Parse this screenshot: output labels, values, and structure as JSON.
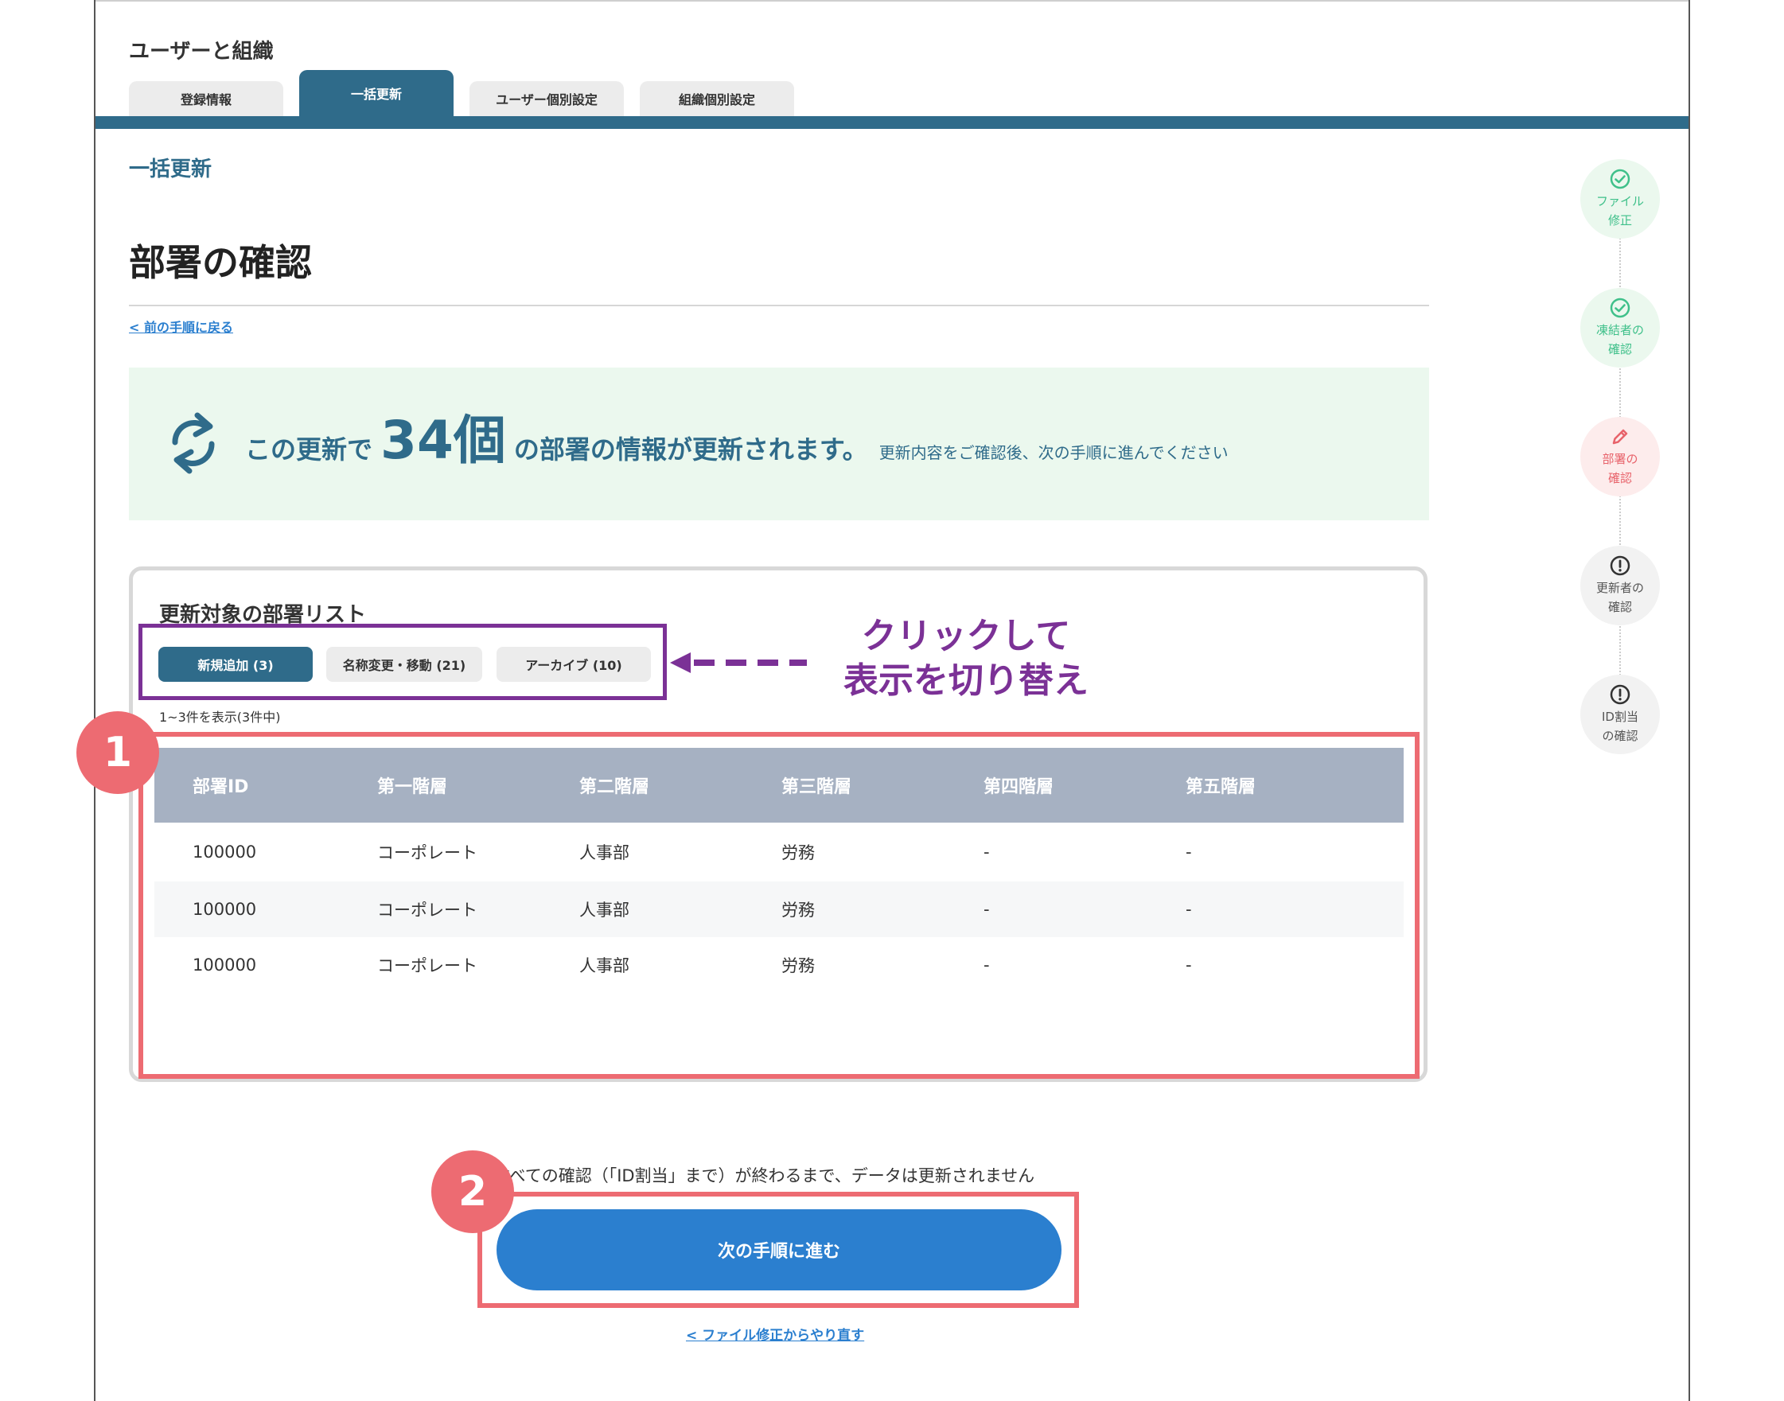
{
  "app": {
    "title": "ユーザーと組織"
  },
  "tabs": [
    {
      "label": "登録情報"
    },
    {
      "label": "一括更新"
    },
    {
      "label": "ユーザー個別設定"
    },
    {
      "label": "組織個別設定"
    }
  ],
  "section_label": "一括更新",
  "page_title": "部署の確認",
  "back_link": "< 前の手順に戻る",
  "banner": {
    "prefix": "この更新で",
    "count": "34個",
    "suffix": "の部署の情報が更新されます。",
    "sub": "更新内容をご確認後、次の手順に進んでください",
    "icon": "sync-icon"
  },
  "list": {
    "title": "更新対象の部署リスト",
    "filters": [
      {
        "label": "新規追加 (3)"
      },
      {
        "label": "名称変更・移動 (21)"
      },
      {
        "label": "アーカイブ (10)"
      }
    ],
    "count_text": "1~3件を表示(3件中)",
    "columns": [
      "部署ID",
      "第一階層",
      "第二階層",
      "第三階層",
      "第四階層",
      "第五階層"
    ],
    "rows": [
      [
        "100000",
        "コーポレート",
        "人事部",
        "労務",
        "-",
        "-"
      ],
      [
        "100000",
        "コーポレート",
        "人事部",
        "労務",
        "-",
        "-"
      ],
      [
        "100000",
        "コーポレート",
        "人事部",
        "労務",
        "-",
        "-"
      ]
    ]
  },
  "annotation": {
    "line1": "クリックして",
    "line2": "表示を切り替え",
    "color": "#7b3196"
  },
  "badges": [
    "1",
    "2"
  ],
  "notice": "すべての確認（「ID割当」まで）が終わるまで、データは更新されません",
  "next_button": "次の手順に進む",
  "redo_link": "< ファイル修正からやり直す",
  "steps": [
    {
      "line1": "ファイル",
      "line2": "修正",
      "status": "done",
      "icon": "check-circle-icon"
    },
    {
      "line1": "凍結者の",
      "line2": "確認",
      "status": "done",
      "icon": "check-circle-icon"
    },
    {
      "line1": "部署の",
      "line2": "確認",
      "status": "current",
      "icon": "pencil-icon"
    },
    {
      "line1": "更新者の",
      "line2": "確認",
      "status": "todo",
      "icon": "exclamation-circle-icon"
    },
    {
      "line1": "ID割当",
      "line2": "の確認",
      "status": "todo",
      "icon": "exclamation-circle-icon"
    }
  ],
  "colors": {
    "primary": "#2f6b8a",
    "button": "#2b7fcf",
    "highlight": "#ed6b72",
    "success": "#3fc08a"
  }
}
